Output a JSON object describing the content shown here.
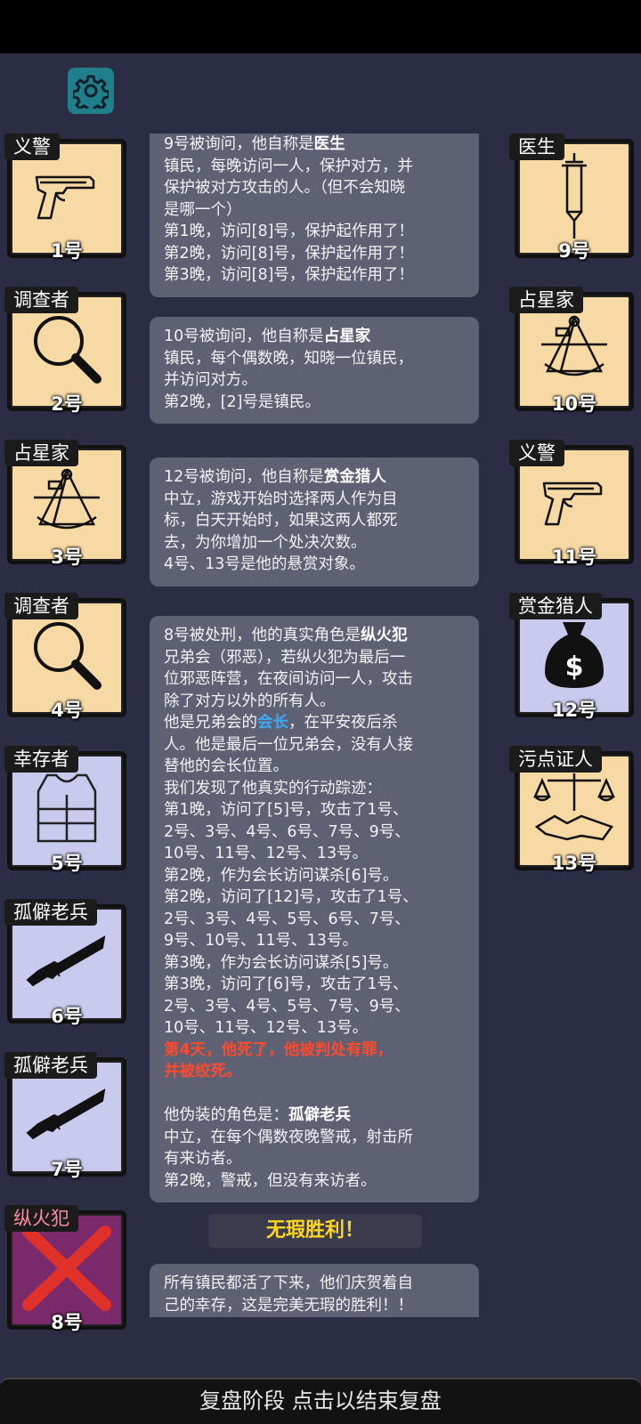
{
  "settings": {
    "icon": "gear-icon"
  },
  "left_cards": [
    {
      "role": "义警",
      "number": "1号",
      "icon": "pistol-icon"
    },
    {
      "role": "调查者",
      "number": "2号",
      "icon": "magnifier-icon"
    },
    {
      "role": "占星家",
      "number": "3号",
      "icon": "sextant-icon"
    },
    {
      "role": "调查者",
      "number": "4号",
      "icon": "magnifier-icon"
    },
    {
      "role": "幸存者",
      "number": "5号",
      "icon": "vest-icon"
    },
    {
      "role": "孤僻老兵",
      "number": "6号",
      "icon": "rifle-icon"
    },
    {
      "role": "孤僻老兵",
      "number": "7号",
      "icon": "rifle-icon"
    },
    {
      "role": "纵火犯",
      "number": "8号",
      "icon": "dead-x-icon"
    }
  ],
  "right_cards": [
    {
      "role": "医生",
      "number": "9号",
      "icon": "syringe-icon"
    },
    {
      "role": "占星家",
      "number": "10号",
      "icon": "sextant-icon"
    },
    {
      "role": "义警",
      "number": "11号",
      "icon": "pistol-icon"
    },
    {
      "role": "赏金猎人",
      "number": "12号",
      "icon": "money-bag-icon"
    },
    {
      "role": "污点证人",
      "number": "13号",
      "icon": "scales-handshake-icon"
    }
  ],
  "log": {
    "m1": {
      "head": "9号被询问，他自称是",
      "role": "医生",
      "lines": [
        "镇民，每晚访问一人，保护对方，并",
        "保护被对方攻击的人。（但不会知晓",
        "是哪一个）",
        "第1晚，访问[8]号，保护起作用了！",
        "第2晚，访问[8]号，保护起作用了！",
        "第3晚，访问[8]号，保护起作用了！"
      ]
    },
    "m2": {
      "head": "10号被询问，他自称是",
      "role": "占星家",
      "lines": [
        "镇民，每个偶数晚，知晓一位镇民，",
        "并访问对方。",
        "第2晚，[2]号是镇民。"
      ]
    },
    "m3": {
      "head": "12号被询问，他自称是",
      "role": "赏金猎人",
      "lines": [
        "中立，游戏开始时选择两人作为目",
        "标，白天开始时，如果这两人都死",
        "去，为你增加一个处决次数。",
        "4号、13号是他的悬赏对象。"
      ]
    },
    "m4": {
      "head": "8号被处刑，他的真实角色是",
      "role": "纵火犯",
      "lines_a": [
        "兄弟会（邪恶），若纵火犯为最后一",
        "位邪恶阵营，在夜间访问一人，攻击",
        "除了对方以外的所有人。"
      ],
      "leader_pre": "他是兄弟会的",
      "leader_word": "会长",
      "leader_post": "，在平安夜后杀",
      "lines_b": [
        "人。他是最后一位兄弟会，没有人接",
        "替他的会长位置。",
        "我们发现了他真实的行动踪迹：",
        "第1晚，访问了[5]号，攻击了1号、",
        "2号、3号、4号、6号、7号、9号、",
        "10号、11号、12号、13号。",
        "第2晚，作为会长访问谋杀[6]号。",
        "第2晚，访问了[12]号，攻击了1号、",
        "2号、3号、4号、5号、6号、7号、",
        "9号、10号、11号、13号。",
        "第3晚，作为会长访问谋杀[5]号。",
        "第3晚，访问了[6]号，攻击了1号、",
        "2号、3号、4号、5号、7号、9号、",
        "10号、11号、12号、13号。"
      ],
      "death_1": "第4天，他死了，他被判处有罪，",
      "death_2": "并被绞死。",
      "disguise_pre": "他伪装的角色是：",
      "disguise_role": "孤僻老兵",
      "lines_c": [
        "中立，在每个偶数夜晚警戒，射击所",
        "有来访者。",
        "第2晚，警戒，但没有来访者。"
      ]
    },
    "banner": "无瑕胜利！",
    "m5": {
      "line1": "所有镇民都活了下来，他们庆贺着自",
      "line2": "己的幸存，这是完美无瑕的胜利！！"
    }
  },
  "bottom": {
    "label": "复盘阶段 点击以结束复盘"
  }
}
